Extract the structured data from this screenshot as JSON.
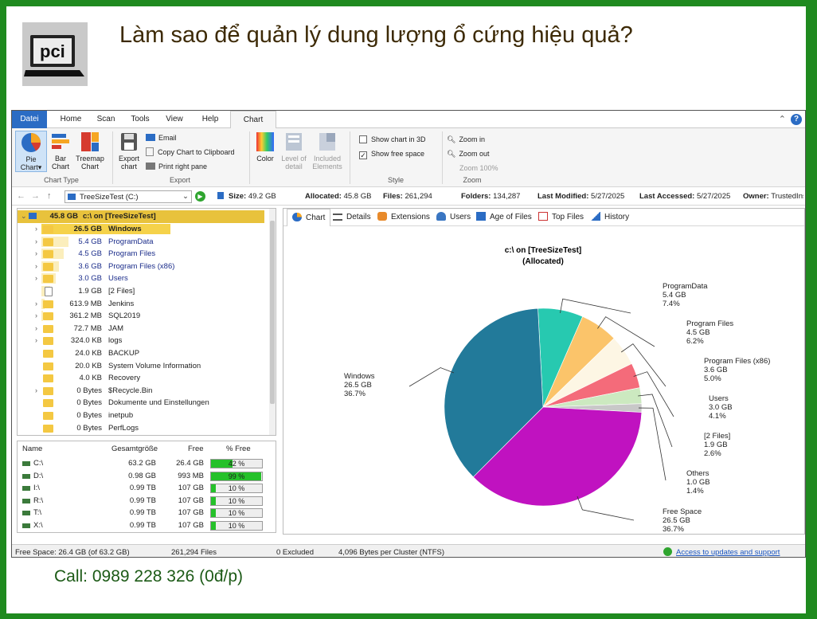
{
  "page": {
    "headline": "Làm sao để quản lý dung lượng ổ cứng hiệu quả?",
    "call": "Call: 0989 228 326 (0đ/p)",
    "logo_text": "pci"
  },
  "menu": [
    "Datei",
    "Home",
    "Scan",
    "Tools",
    "View",
    "Help",
    "Chart"
  ],
  "ribbon": {
    "pie_chart": "Pie Chart",
    "pie_chart_arrow": "▾",
    "bar_chart": "Bar Chart",
    "treemap_chart": "Treemap Chart",
    "chart_type": "Chart Type",
    "export_chart": "Export chart",
    "email": "Email",
    "copy_chart": "Copy Chart to Clipboard",
    "print_pane": "Print right pane",
    "export": "Export",
    "color": "Color",
    "level_of_detail": "Level of detail",
    "included_elements": "Included Elements",
    "show_3d": "Show chart in 3D",
    "show_free": "Show free space",
    "style": "Style",
    "zoom_in": "Zoom in",
    "zoom_out": "Zoom out",
    "zoom_100": "Zoom 100%",
    "zoom": "Zoom"
  },
  "address": {
    "path": "TreeSizeTest (C:)",
    "size_label": "Size:",
    "size": "49.2 GB",
    "allocated_label": "Allocated:",
    "allocated": "45.8 GB",
    "files_label": "Files:",
    "files": "261,294",
    "folders_label": "Folders:",
    "folders": "134,287",
    "last_modified_label": "Last Modified:",
    "last_modified": "5/27/2025",
    "last_accessed_label": "Last Accessed:",
    "last_accessed": "5/27/2025",
    "owner_label": "Owner:",
    "owner": "TrustedInstaller"
  },
  "tree": {
    "root": {
      "size": "45.8 GB",
      "name": "c:\\  on  [TreeSizeTest]"
    },
    "rows": [
      {
        "size": "26.5 GB",
        "name": "Windows",
        "chev": "›",
        "pct": 0.58,
        "style": "sel",
        "type": "folder"
      },
      {
        "size": "5.4 GB",
        "name": "ProgramData",
        "chev": "›",
        "pct": 0.12,
        "style": "blue",
        "type": "folder"
      },
      {
        "size": "4.5 GB",
        "name": "Program Files",
        "chev": "›",
        "pct": 0.1,
        "style": "blue",
        "type": "folder"
      },
      {
        "size": "3.6 GB",
        "name": "Program Files (x86)",
        "chev": "›",
        "pct": 0.08,
        "style": "blue",
        "type": "folder"
      },
      {
        "size": "3.0 GB",
        "name": "Users",
        "chev": "›",
        "pct": 0.066,
        "style": "blue",
        "type": "folder"
      },
      {
        "size": "1.9 GB",
        "name": "[2 Files]",
        "chev": "",
        "pct": 0.04,
        "style": "",
        "type": "file"
      },
      {
        "size": "613.9 MB",
        "name": "Jenkins",
        "chev": "›",
        "pct": 0.013,
        "style": "",
        "type": "folder"
      },
      {
        "size": "361.2 MB",
        "name": "SQL2019",
        "chev": "›",
        "pct": 0.008,
        "style": "",
        "type": "folder"
      },
      {
        "size": "72.7 MB",
        "name": "JAM",
        "chev": "›",
        "pct": 0,
        "style": "",
        "type": "folder"
      },
      {
        "size": "324.0 KB",
        "name": "logs",
        "chev": "›",
        "pct": 0,
        "style": "",
        "type": "folder"
      },
      {
        "size": "24.0 KB",
        "name": "BACKUP",
        "chev": "",
        "pct": 0,
        "style": "",
        "type": "folder"
      },
      {
        "size": "20.0 KB",
        "name": "System Volume Information",
        "chev": "",
        "pct": 0,
        "style": "",
        "type": "folder"
      },
      {
        "size": "4.0 KB",
        "name": "Recovery",
        "chev": "",
        "pct": 0,
        "style": "",
        "type": "folder"
      },
      {
        "size": "0 Bytes",
        "name": "$Recycle.Bin",
        "chev": "›",
        "pct": 0,
        "style": "",
        "type": "folder"
      },
      {
        "size": "0 Bytes",
        "name": "Dokumente und Einstellungen",
        "chev": "",
        "pct": 0,
        "style": "",
        "type": "folder"
      },
      {
        "size": "0 Bytes",
        "name": "inetpub",
        "chev": "",
        "pct": 0,
        "style": "",
        "type": "folder"
      },
      {
        "size": "0 Bytes",
        "name": "PerfLogs",
        "chev": "",
        "pct": 0,
        "style": "",
        "type": "folder"
      }
    ]
  },
  "drives": {
    "headers": {
      "name": "Name",
      "total": "Gesamtgröße",
      "free": "Free",
      "pct": "% Free"
    },
    "rows": [
      {
        "name": "C:\\",
        "total": "63.2 GB",
        "free": "26.4 GB",
        "pct_label": "42 %",
        "pct": 42
      },
      {
        "name": "D:\\",
        "total": "0.98 GB",
        "free": "993 MB",
        "pct_label": "99 %",
        "pct": 99
      },
      {
        "name": "I:\\",
        "total": "0.99 TB",
        "free": "107 GB",
        "pct_label": "10 %",
        "pct": 10
      },
      {
        "name": "R:\\",
        "total": "0.99 TB",
        "free": "107 GB",
        "pct_label": "10 %",
        "pct": 10
      },
      {
        "name": "T:\\",
        "total": "0.99 TB",
        "free": "107 GB",
        "pct_label": "10 %",
        "pct": 10
      },
      {
        "name": "X:\\",
        "total": "0.99 TB",
        "free": "107 GB",
        "pct_label": "10 %",
        "pct": 10
      }
    ]
  },
  "right_tabs": [
    "Chart",
    "Details",
    "Extensions",
    "Users",
    "Age of Files",
    "Top Files",
    "History"
  ],
  "chart_data": {
    "type": "pie",
    "title": "c:\\  on  [TreeSizeTest]",
    "subtitle": "(Allocated)",
    "slices": [
      {
        "label": "ProgramData",
        "value_text": "5.4 GB",
        "percent": 7.4,
        "color": "#27c9b0"
      },
      {
        "label": "Program Files",
        "value_text": "4.5 GB",
        "percent": 6.2,
        "color": "#fbc46a"
      },
      {
        "label": "Program Files (x86)",
        "value_text": "3.6 GB",
        "percent": 5.0,
        "color": "#fdf6e4"
      },
      {
        "label": "Users",
        "value_text": "3.0 GB",
        "percent": 4.1,
        "color": "#f46b7a"
      },
      {
        "label": "[2 Files]",
        "value_text": "1.9 GB",
        "percent": 2.6,
        "color": "#cce9c0"
      },
      {
        "label": "Others",
        "value_text": "1.0 GB",
        "percent": 1.4,
        "color": "#c8c8c8"
      },
      {
        "label": "Free Space",
        "value_text": "26.5 GB",
        "percent": 36.7,
        "color": "#c012c0"
      },
      {
        "label": "Windows",
        "value_text": "26.5 GB",
        "percent": 36.7,
        "color": "#227a9a"
      }
    ]
  },
  "status": {
    "free_space": "Free Space: 26.4 GB  (of 63.2 GB)",
    "files": "261,294 Files",
    "excluded": "0 Excluded",
    "cluster": "4,096 Bytes per Cluster (NTFS)",
    "updates": "Access to updates and support"
  }
}
